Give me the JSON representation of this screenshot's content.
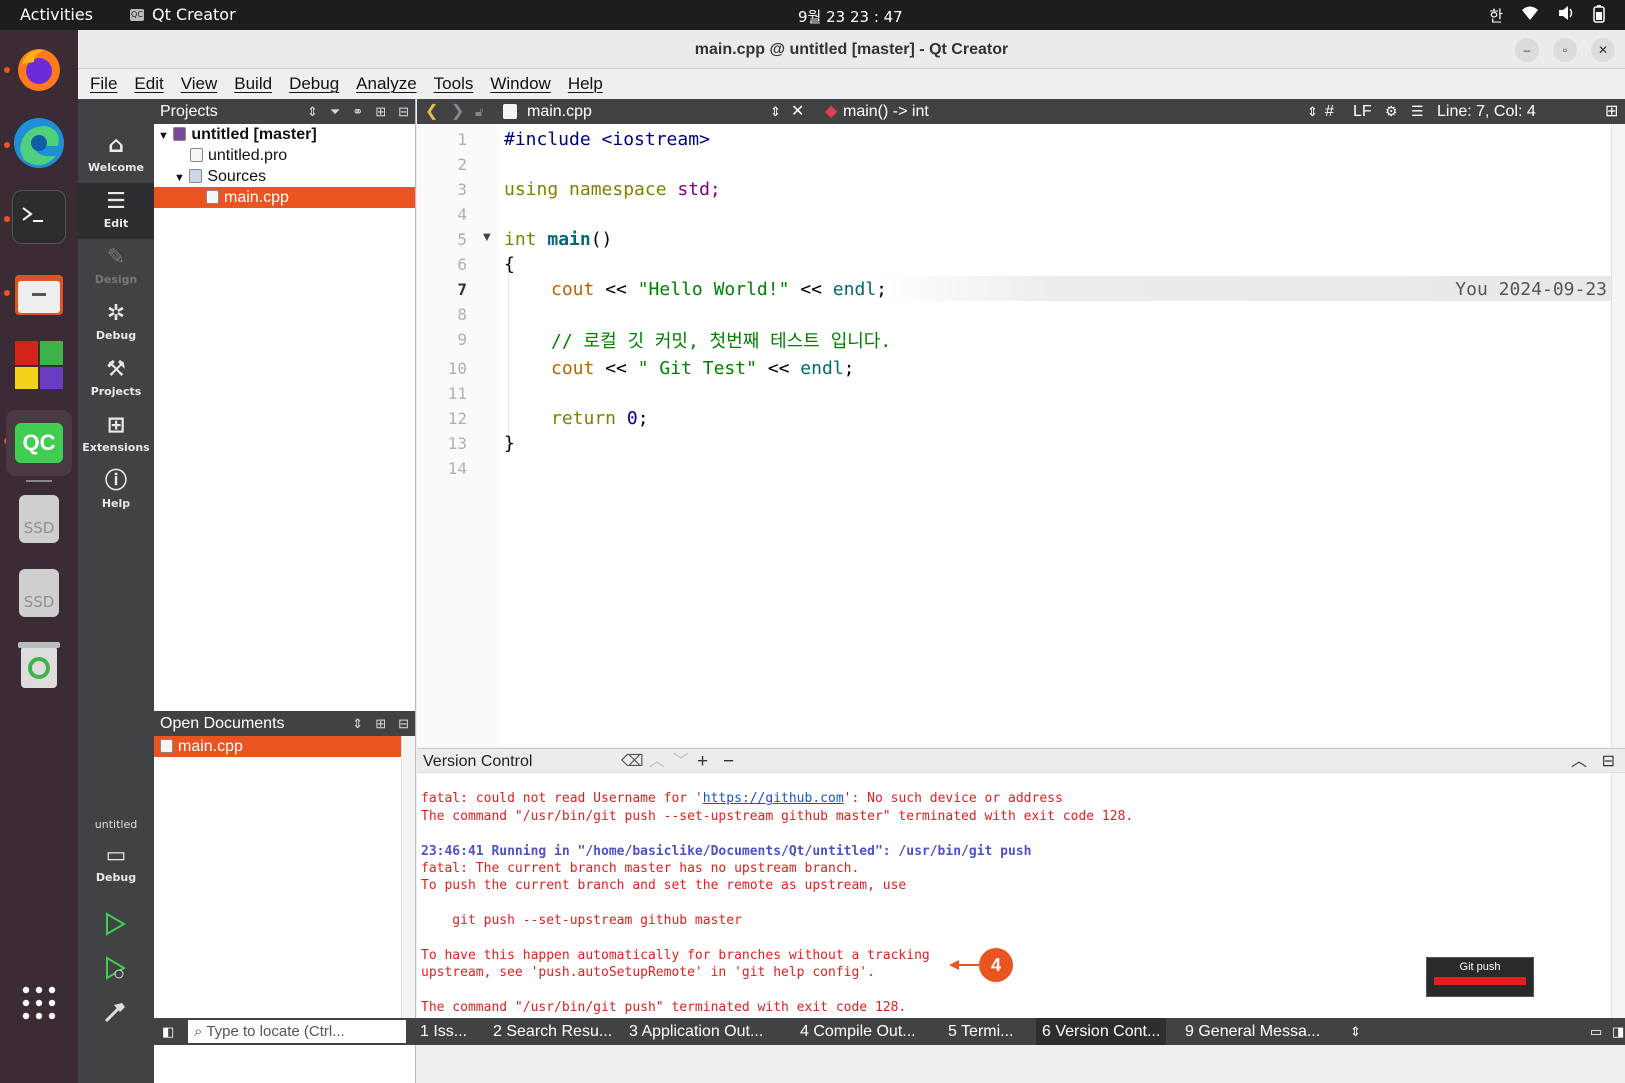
{
  "topbar": {
    "activities": "Activities",
    "app_name": "Qt Creator",
    "app_icon_text": "QC",
    "clock": "9월 23  23 : 47",
    "ime": "한"
  },
  "window": {
    "title": "main.cpp @ untitled [master] - Qt Creator"
  },
  "menu": [
    "File",
    "Edit",
    "View",
    "Build",
    "Debug",
    "Analyze",
    "Tools",
    "Window",
    "Help"
  ],
  "modes": [
    {
      "label": "Welcome",
      "icon": "home-icon"
    },
    {
      "label": "Edit",
      "icon": "edit-icon"
    },
    {
      "label": "Design",
      "icon": "design-icon"
    },
    {
      "label": "Debug",
      "icon": "debug-icon"
    },
    {
      "label": "Projects",
      "icon": "wrench-icon"
    },
    {
      "label": "Extensions",
      "icon": "extensions-icon"
    },
    {
      "label": "Help",
      "icon": "help-icon"
    }
  ],
  "kit": {
    "project": "untitled",
    "config": "Debug"
  },
  "projects": {
    "header": "Projects",
    "tree": [
      {
        "label": "untitled [master]",
        "level": 0
      },
      {
        "label": "untitled.pro",
        "level": 1
      },
      {
        "label": "Sources",
        "level": 1
      },
      {
        "label": "main.cpp",
        "level": 2
      }
    ]
  },
  "open_documents": {
    "header": "Open Documents",
    "items": [
      "main.cpp"
    ]
  },
  "editor": {
    "file": "main.cpp",
    "symbol": "main() -> int",
    "hash": "#",
    "line_ending": "LF",
    "position": "Line: 7, Col: 4",
    "blame": "You 2024-09-23",
    "line_numbers": [
      "1",
      "2",
      "3",
      "4",
      "5",
      "6",
      "7",
      "8",
      "9",
      "10",
      "11",
      "12",
      "13",
      "14"
    ],
    "lines": {
      "l1_pp": "#include <iostream>",
      "l3_kw": "using namespace ",
      "l3_rest": "std;",
      "l5_kw": "int ",
      "l5_fn": "main",
      "l5_rest": "()",
      "l6": "{",
      "l7_a": "cout",
      "l7_b": " << ",
      "l7_c": "\"Hello World!\"",
      "l7_d": " << ",
      "l7_e": "endl",
      "l7_f": ";",
      "l9": "// 로컬 깃 커밋, 첫번째 테스트 입니다.",
      "l10_a": "cout",
      "l10_b": " << ",
      "l10_c": "\" Git Test\"",
      "l10_d": " << ",
      "l10_e": "endl",
      "l10_f": ";",
      "l12_a": "return ",
      "l12_b": "0",
      "l12_c": ";",
      "l13": "}"
    }
  },
  "version_control": {
    "header": "Version Control",
    "lines": {
      "a1": "fatal: could not read Username for '",
      "a_link": "https://github.com",
      "a2": "': No such device or address",
      "b": "The command \"/usr/bin/git push --set-upstream github master\" terminated with exit code 128.",
      "c": "23:46:41 Running in \"/home/basiclike/Documents/Qt/untitled\": /usr/bin/git push",
      "d": "fatal: The current branch master has no upstream branch.",
      "e": "To push the current branch and set the remote as upstream, use",
      "f": "    git push --set-upstream github master",
      "g": "To have this happen automatically for branches without a tracking",
      "h": "upstream, see 'push.autoSetupRemote' in 'git help config'.",
      "i": "The command \"/usr/bin/git push\" terminated with exit code 128."
    },
    "annotation": "4"
  },
  "git_push_popup": {
    "label": "Git push",
    "progress": 1.0
  },
  "statusbar": {
    "locator": "Type to locate (Ctrl...",
    "tabs": [
      "1  Iss...",
      "2  Search Resu...",
      "3  Application Out...",
      "4  Compile Out...",
      "5  Termi...",
      "6  Version Cont...",
      "9  General Messa..."
    ]
  },
  "colors": {
    "accent": "#e95420",
    "chrome": "#404244",
    "error": "#e02020",
    "info": "#5050c8",
    "keyword": "#808000",
    "member": "#c06000",
    "string": "#008000",
    "type": "#000080"
  }
}
